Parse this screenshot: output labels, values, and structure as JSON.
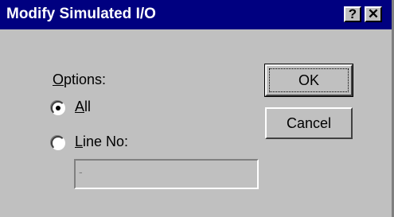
{
  "window": {
    "title": "Modify Simulated I/O",
    "help_button": "?",
    "close_button": "✕"
  },
  "options": {
    "label": "Options:",
    "all": {
      "label": "All",
      "selected": true
    },
    "line_no": {
      "label": "Line No:",
      "selected": false
    }
  },
  "line_field": {
    "value": "-",
    "enabled": false
  },
  "buttons": {
    "ok": "OK",
    "cancel": "Cancel"
  }
}
